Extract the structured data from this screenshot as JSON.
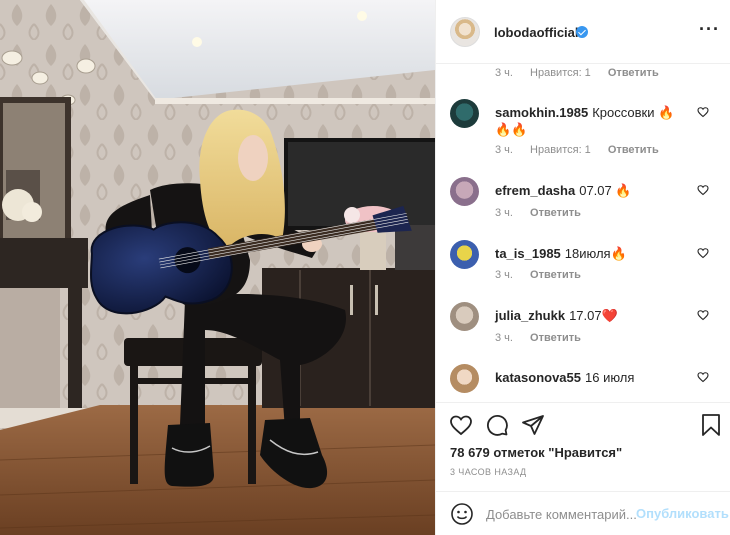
{
  "post": {
    "author": "lobodaofficial",
    "verified": true,
    "photo_alt": "Woman with long blonde hair playing a blue acoustic guitar, sitting on a chair in a room"
  },
  "comments": {
    "top_partial": {
      "time": "3 ч.",
      "likes": "Нравится: 1",
      "reply": "Ответить"
    },
    "items": [
      {
        "user": "samokhin.1985",
        "text": "Кроссовки 🔥🔥🔥",
        "time": "3 ч.",
        "likes": "Нравится: 1",
        "reply": "Ответить"
      },
      {
        "user": "efrem_dasha",
        "text": "07.07 🔥",
        "time": "3 ч.",
        "likes": "",
        "reply": "Ответить"
      },
      {
        "user": "ta_is_1985",
        "text": "18июля🔥",
        "time": "3 ч.",
        "likes": "",
        "reply": "Ответить"
      },
      {
        "user": "julia_zhukk",
        "text": "17.07❤️",
        "time": "3 ч.",
        "likes": "",
        "reply": "Ответить"
      },
      {
        "user": "katasonova55",
        "text": "16 июля",
        "time": "",
        "likes": "",
        "reply": ""
      }
    ]
  },
  "actions": {
    "icons": [
      "heart-icon",
      "comment-icon",
      "share-icon",
      "bookmark-icon"
    ],
    "likes_count": "78 679 отметок \"Нравится\"",
    "time_ago": "3 ЧАСОВ НАЗАД"
  },
  "add_comment": {
    "placeholder": "Добавьте комментарий...",
    "post_label": "Опубликовать"
  },
  "colors": {
    "link_blue": "#3897f0",
    "post_disabled": "#b2dffc",
    "muted": "#8e8e8e",
    "text": "#262626",
    "heart_red": "#ed4956"
  }
}
